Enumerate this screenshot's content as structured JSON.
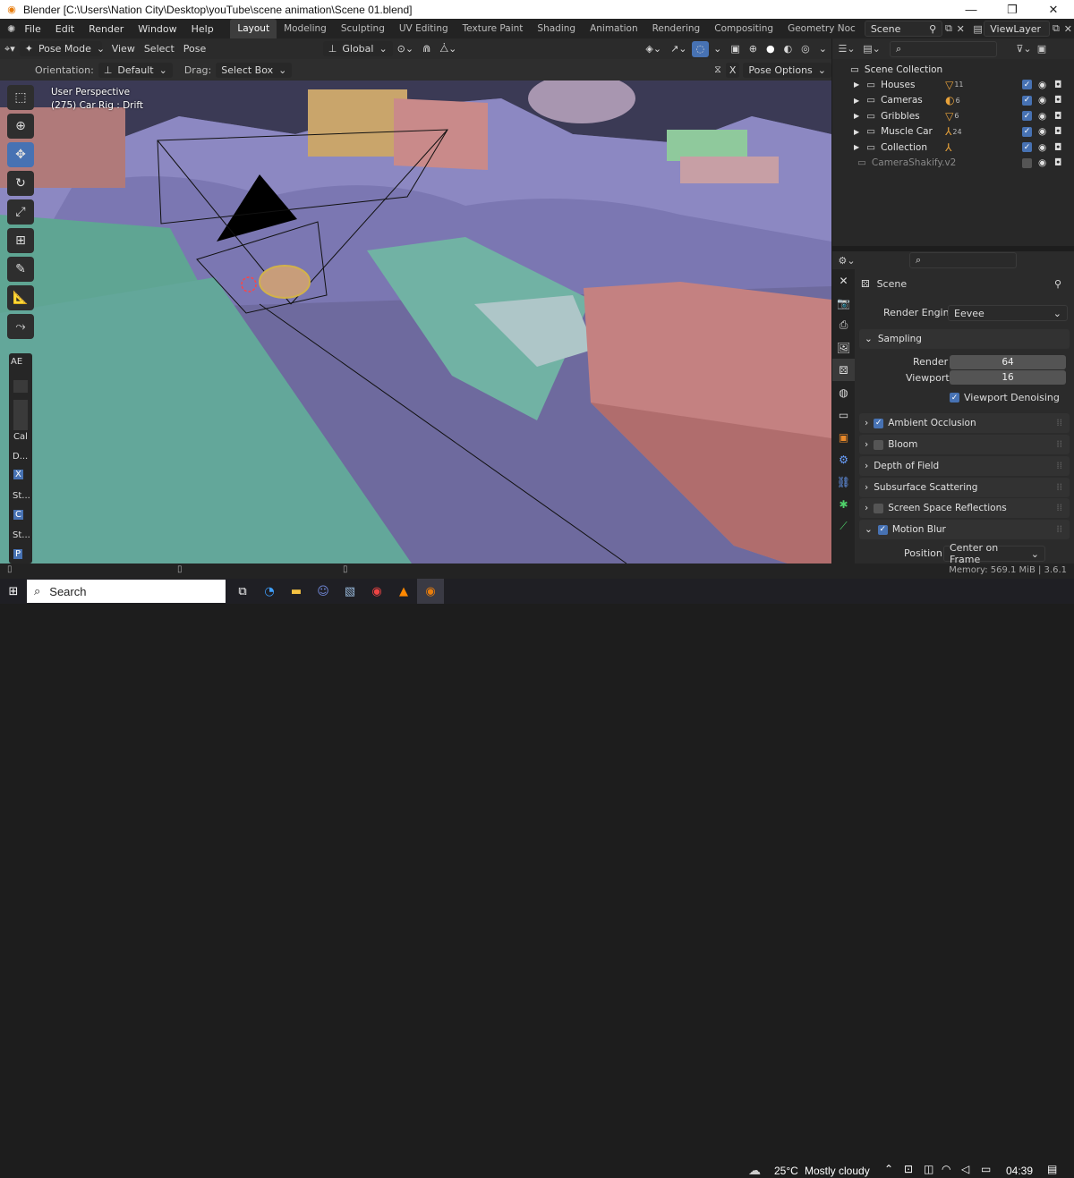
{
  "window": {
    "title": "Blender [C:\\Users\\Nation City\\Desktop\\youTube\\scene animation\\Scene 01.blend]",
    "minimize": "—",
    "maximize": "❐",
    "close": "✕"
  },
  "menubar": {
    "items": [
      "File",
      "Edit",
      "Render",
      "Window",
      "Help"
    ],
    "workspaces": [
      "Layout",
      "Modeling",
      "Sculpting",
      "UV Editing",
      "Texture Paint",
      "Shading",
      "Animation",
      "Rendering",
      "Compositing",
      "Geometry Noc"
    ],
    "active_workspace": "Layout",
    "scene": "Scene",
    "view_layer": "ViewLayer"
  },
  "viewport_header": {
    "mode": "Pose Mode",
    "menus": [
      "View",
      "Select",
      "Pose"
    ],
    "transform_orientation": "Global",
    "orientation_label": "Orientation:",
    "orientation_value": "Default",
    "drag_label": "Drag:",
    "drag_value": "Select Box",
    "pose_options": "Pose Options",
    "x_label": "X"
  },
  "viewport": {
    "view_name": "User Perspective",
    "object_info": "(275) Car Rig : Drift",
    "sidebar_labels": [
      "AE",
      "Cal",
      "D...",
      "X",
      "St...",
      "C",
      "St...",
      "P"
    ]
  },
  "outliner": {
    "root": "Scene Collection",
    "items": [
      {
        "name": "Houses",
        "badge": "11",
        "checked": true
      },
      {
        "name": "Cameras",
        "badge": "6",
        "checked": true
      },
      {
        "name": "Gribbles",
        "badge": "6",
        "checked": true
      },
      {
        "name": "Muscle Car",
        "badge": "24",
        "checked": true
      },
      {
        "name": "Collection",
        "badge": "",
        "checked": true
      },
      {
        "name": "CameraShakify.v2",
        "badge": "",
        "checked": false
      }
    ]
  },
  "properties": {
    "context": "Scene",
    "render_engine_label": "Render Engine",
    "render_engine": "Eevee",
    "sampling": {
      "title": "Sampling",
      "render_label": "Render",
      "render": "64",
      "viewport_label": "Viewport",
      "viewport": "16",
      "denoise_label": "Viewport Denoising"
    },
    "panels": [
      {
        "label": "Ambient Occlusion",
        "check": true,
        "checked": true
      },
      {
        "label": "Bloom",
        "check": true,
        "checked": false
      },
      {
        "label": "Depth of Field",
        "check": false,
        "checked": false
      },
      {
        "label": "Subsurface Scattering",
        "check": false,
        "checked": false
      },
      {
        "label": "Screen Space Reflections",
        "check": true,
        "checked": false
      },
      {
        "label": "Motion Blur",
        "check": true,
        "checked": true
      }
    ],
    "motion_blur": {
      "position_label": "Position",
      "position": "Center on Frame"
    }
  },
  "statusbar": {
    "memory": "Memory: 569.1 MiB | 3.6.1"
  },
  "taskbar": {
    "search": "Search",
    "weather_temp": "25°C",
    "weather_text": "Mostly cloudy",
    "time": "04:39"
  },
  "colors": {
    "accent": "#4772b3",
    "terrain": "#7370a8",
    "teal_house": "#73b3a1",
    "pink_house": "#c98a8a",
    "orange_house": "#c9a56b"
  }
}
